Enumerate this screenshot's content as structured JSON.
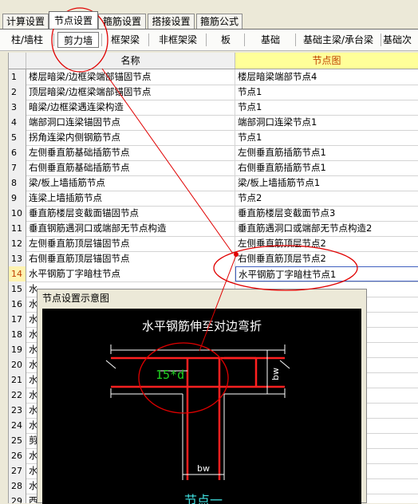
{
  "main_tabs": [
    "计算设置",
    "节点设置",
    "箍筋设置",
    "搭接设置",
    "箍筋公式"
  ],
  "active_main_tab": 1,
  "sub_tabs": [
    "柱/墙柱",
    "剪力墙",
    "框架梁",
    "非框架梁",
    "板",
    "基础",
    "基础主梁/承台梁",
    "基础次"
  ],
  "active_sub_tab": 1,
  "columns": {
    "name": "名称",
    "node": "节点图"
  },
  "rows": [
    {
      "n": "1",
      "name": "楼层暗梁/边框梁端部锚固节点",
      "node": "楼层暗梁端部节点4"
    },
    {
      "n": "2",
      "name": "顶层暗梁/边框梁端部锚固节点",
      "node": "节点1"
    },
    {
      "n": "3",
      "name": "暗梁/边框梁遇连梁构造",
      "node": "节点1"
    },
    {
      "n": "4",
      "name": "端部洞口连梁锚固节点",
      "node": "端部洞口连梁节点1"
    },
    {
      "n": "5",
      "name": "拐角连梁内侧钢筋节点",
      "node": "节点1"
    },
    {
      "n": "6",
      "name": "左侧垂直筋基础插筋节点",
      "node": "左侧垂直筋插筋节点1"
    },
    {
      "n": "7",
      "name": "右侧垂直筋基础插筋节点",
      "node": "右侧垂直筋插筋节点1"
    },
    {
      "n": "8",
      "name": "梁/板上墙插筋节点",
      "node": "梁/板上墙插筋节点1"
    },
    {
      "n": "9",
      "name": "连梁上墙插筋节点",
      "node": "节点2"
    },
    {
      "n": "10",
      "name": "垂直筋楼层变截面锚固节点",
      "node": "垂直筋楼层变截面节点3"
    },
    {
      "n": "11",
      "name": "垂直钢筋遇洞口或端部无节点构造",
      "node": "垂直筋遇洞口或端部无节点构造2"
    },
    {
      "n": "12",
      "name": "左侧垂直筋顶层锚固节点",
      "node": "左侧垂直筋顶层节点2"
    },
    {
      "n": "13",
      "name": "右侧垂直筋顶层锚固节点",
      "node": "右侧垂直筋顶层节点2"
    },
    {
      "n": "14",
      "name": "水平钢筋丁字暗柱节点",
      "node": "水平钢筋丁字暗柱节点1"
    },
    {
      "n": "15",
      "name": "水",
      "node": ""
    },
    {
      "n": "16",
      "name": "水",
      "node": ""
    },
    {
      "n": "17",
      "name": "水",
      "node": ""
    },
    {
      "n": "18",
      "name": "水",
      "node": ""
    },
    {
      "n": "19",
      "name": "水",
      "node": ""
    },
    {
      "n": "20",
      "name": "水",
      "node": ""
    },
    {
      "n": "21",
      "name": "水",
      "node": ""
    },
    {
      "n": "22",
      "name": "水",
      "node": ""
    },
    {
      "n": "23",
      "name": "水",
      "node": ""
    },
    {
      "n": "24",
      "name": "水",
      "node": ""
    },
    {
      "n": "25",
      "name": "剪",
      "node": ""
    },
    {
      "n": "26",
      "name": "水",
      "node": ""
    },
    {
      "n": "27",
      "name": "水",
      "node": ""
    },
    {
      "n": "28",
      "name": "水",
      "node": "构造2"
    },
    {
      "n": "29",
      "name": "西",
      "node": ""
    }
  ],
  "selected_row": 14,
  "dialog": {
    "title": "节点设置示意图",
    "heading": "水平钢筋伸至对边弯折",
    "dim_label": "15*d",
    "bw_label": "bw",
    "caption": "节点一"
  },
  "colors": {
    "accent_header": "#ffff99",
    "annotation": "#e00000",
    "rebar": "#ff2020",
    "dim_green": "#20d020"
  }
}
